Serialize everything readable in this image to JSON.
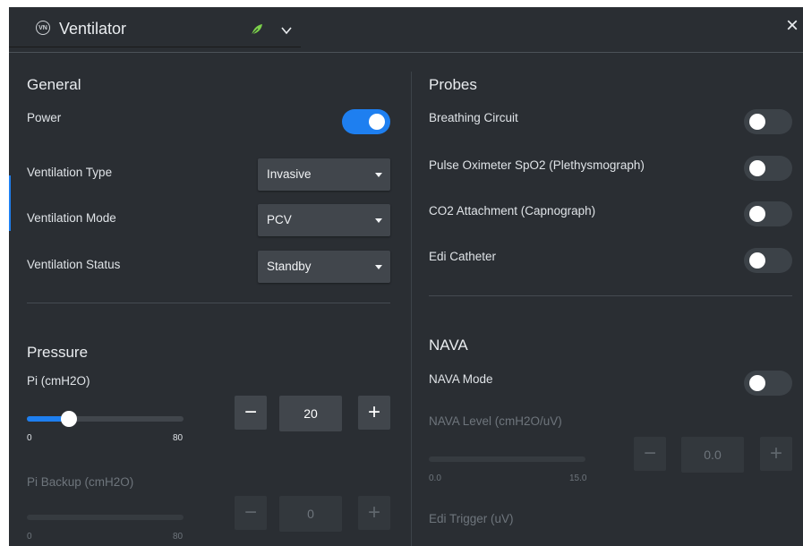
{
  "header": {
    "logo_text": "VN",
    "title": "Ventilator",
    "close_glyph": "×",
    "icons": [
      "leaf-icon",
      "chevron-down-icon",
      "close-icon"
    ]
  },
  "general": {
    "heading": "General",
    "power": {
      "label": "Power",
      "on": true
    },
    "ventilation_type": {
      "label": "Ventilation Type",
      "value": "Invasive"
    },
    "ventilation_mode": {
      "label": "Ventilation Mode",
      "value": "PCV"
    },
    "ventilation_status": {
      "label": "Ventilation Status",
      "value": "Standby"
    }
  },
  "pressure": {
    "heading": "Pressure",
    "pi": {
      "label": "Pi (cmH2O)",
      "value": "20",
      "min": "0",
      "max": "80",
      "minus": "−",
      "plus": "+"
    },
    "pi_backup": {
      "label": "Pi Backup (cmH2O)",
      "value": "0",
      "min": "0",
      "max": "80",
      "minus": "−",
      "plus": "+"
    }
  },
  "probes": {
    "heading": "Probes",
    "breathing_circuit": {
      "label": "Breathing Circuit",
      "on": false
    },
    "pulse_oximeter": {
      "label": "Pulse Oximeter SpO2 (Plethysmograph)",
      "on": false
    },
    "co2_attachment": {
      "label": "CO2 Attachment (Capnograph)",
      "on": false
    },
    "edi_catheter": {
      "label": "Edi Catheter",
      "on": false
    }
  },
  "nava": {
    "heading": "NAVA",
    "mode": {
      "label": "NAVA Mode",
      "on": false
    },
    "level": {
      "label": "NAVA Level (cmH2O/uV)",
      "value": "0.0",
      "min": "0.0",
      "max": "15.0",
      "minus": "−",
      "plus": "+"
    },
    "edi_trigger": {
      "label": "Edi Trigger (uV)"
    }
  },
  "colors": {
    "panel": "#2a2e33",
    "accent": "#1e7ff0",
    "control": "#41464c"
  }
}
